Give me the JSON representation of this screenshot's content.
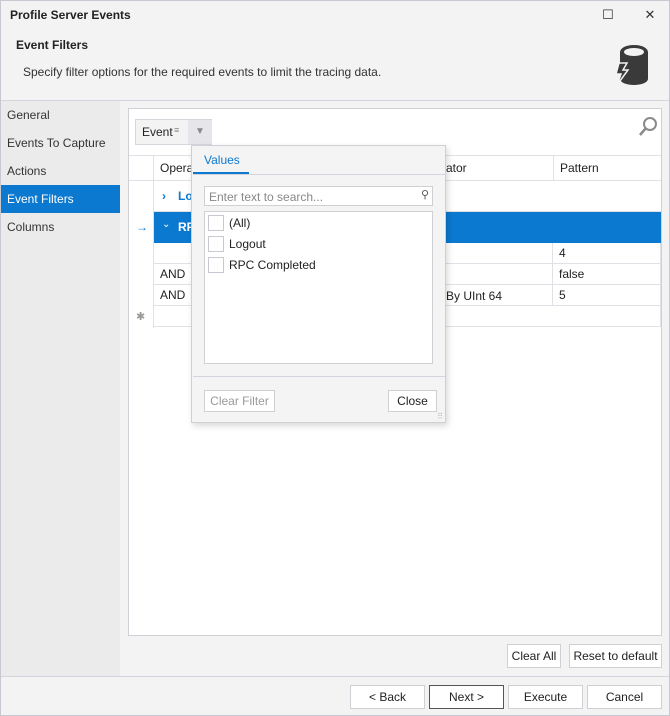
{
  "window": {
    "title": "Profile Server Events",
    "maximize_icon": "maximize-icon",
    "close_icon": "close-icon"
  },
  "header": {
    "title": "Event Filters",
    "description": "Specify filter options for the required events to limit the tracing data.",
    "icon": "database-lightning-icon"
  },
  "sidebar": {
    "items": [
      {
        "label": "General"
      },
      {
        "label": "Events To Capture"
      },
      {
        "label": "Actions"
      },
      {
        "label": "Event Filters",
        "selected": true
      },
      {
        "label": "Columns"
      }
    ]
  },
  "grid": {
    "group_chip": "Event",
    "columns": [
      "Opera",
      "ator",
      "Pattern"
    ],
    "groups": [
      {
        "label": "Lo",
        "expanded": false
      },
      {
        "label": "RP",
        "expanded": true,
        "selected": true
      }
    ],
    "rows": [
      {
        "operator": "",
        "op": "",
        "pattern": "4"
      },
      {
        "operator": "AND",
        "op": "",
        "pattern": "false"
      },
      {
        "operator": "AND",
        "op": "By UInt 64",
        "pattern": "5"
      }
    ]
  },
  "filter_popup": {
    "tab": "Values",
    "search_placeholder": "Enter text to search...",
    "values": [
      {
        "label": "(All)",
        "checked": false
      },
      {
        "label": "Logout",
        "checked": false
      },
      {
        "label": "RPC Completed",
        "checked": false
      }
    ],
    "clear_filter": "Clear Filter",
    "close": "Close"
  },
  "actions": {
    "clear_all": "Clear All",
    "reset": "Reset to default"
  },
  "footer": {
    "back": "< Back",
    "next": "Next >",
    "execute": "Execute",
    "cancel": "Cancel"
  },
  "colors": {
    "accent": "#0b79d0"
  }
}
